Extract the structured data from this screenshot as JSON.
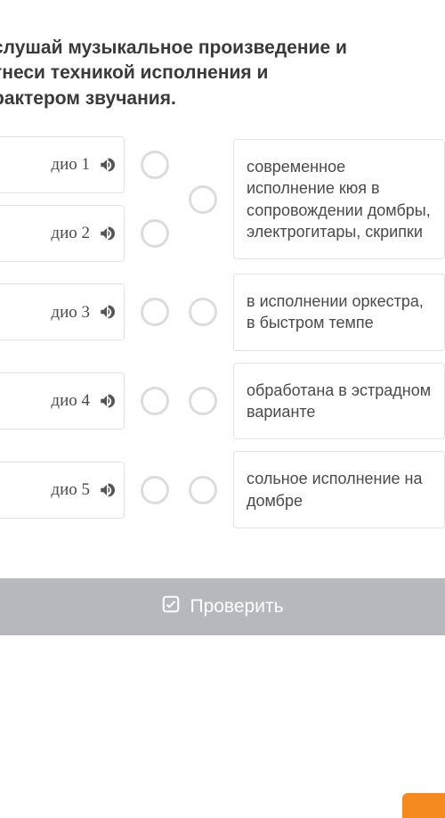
{
  "instruction": "слушай музыкальное произведение и\nтнеси техникой исполнения и\nрактером звучания.",
  "audios": [
    {
      "label": "дио 1"
    },
    {
      "label": "дио 2"
    },
    {
      "label": "дио 3"
    },
    {
      "label": "дио 4"
    },
    {
      "label": "дио 5"
    }
  ],
  "descriptions": [
    "современное исполнение кюя в сопровождении домбры, электрогитары, скрипки",
    "в исполнении оркестра, в быстром темпе",
    "обработана в эстрадном варианте",
    "сольное исполнение на домбре"
  ],
  "checkLabel": "Проверить"
}
